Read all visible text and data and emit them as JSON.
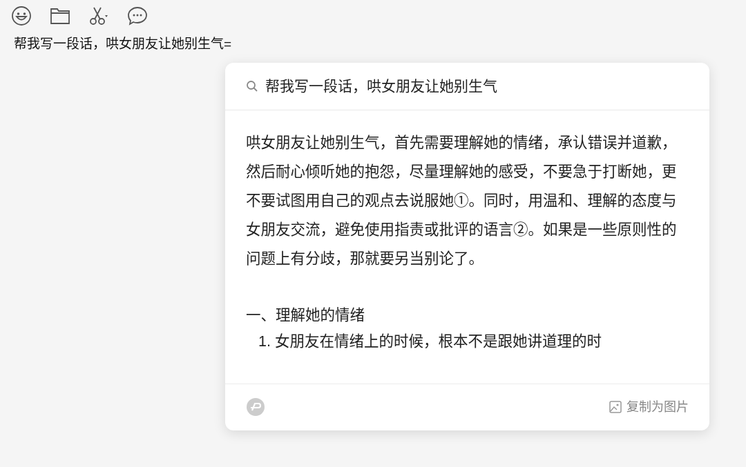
{
  "message_input": {
    "value": "帮我写一段话，哄女朋友让她别生气="
  },
  "popup": {
    "query": "帮我写一段话，哄女朋友让她别生气",
    "answer": [
      {
        "kind": "paragraph",
        "text": "哄女朋友让她别生气，首先需要理解她的情绪，承认错误并道歉，然后耐心倾听她的抱怨，尽量理解她的感受，不要急于打断她，更不要试图用自己的观点去说服她①。同时，用温和、理解的态度与女朋友交流，避免使用指责或批评的语言②。如果是一些原则性的问题上有分歧，那就要另当别论了。"
      },
      {
        "kind": "heading",
        "text": "一、理解她的情绪"
      },
      {
        "kind": "list_item",
        "number": "1.",
        "text": "女朋友在情绪上的时候，根本不是跟她讲道理的时"
      }
    ],
    "copy_button": "复制为图片"
  }
}
